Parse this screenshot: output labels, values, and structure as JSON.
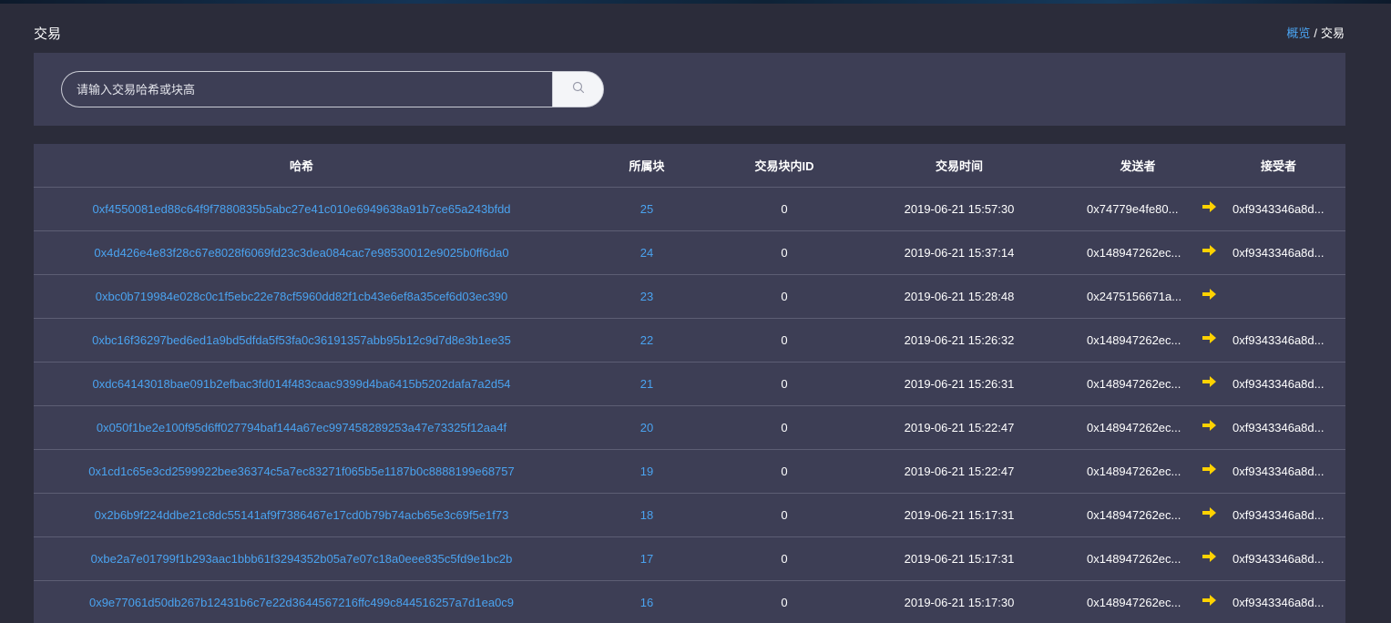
{
  "header": {
    "title": "交易",
    "breadcrumb": {
      "home": "概览",
      "separator": "/",
      "current": "交易"
    }
  },
  "search": {
    "placeholder": "请输入交易哈希或块高",
    "value": "",
    "icon": "search-icon"
  },
  "table": {
    "columns": {
      "hash": "哈希",
      "block": "所属块",
      "tx_index": "交易块内ID",
      "time": "交易时间",
      "sender": "发送者",
      "receiver": "接受者"
    },
    "arrow_icon": "arrow-right-icon",
    "arrow_color": "#ffd200",
    "link_color": "#4aa3f0",
    "rows": [
      {
        "hash": "0xf4550081ed88c64f9f7880835b5abc27e41c010e6949638a91b7ce65a243bfdd",
        "block": "25",
        "tx_index": "0",
        "time": "2019-06-21 15:57:30",
        "sender": "0x74779e4fe80...",
        "receiver": "0xf9343346a8d..."
      },
      {
        "hash": "0x4d426e4e83f28c67e8028f6069fd23c3dea084cac7e98530012e9025b0ff6da0",
        "block": "24",
        "tx_index": "0",
        "time": "2019-06-21 15:37:14",
        "sender": "0x148947262ec...",
        "receiver": "0xf9343346a8d..."
      },
      {
        "hash": "0xbc0b719984e028c0c1f5ebc22e78cf5960dd82f1cb43e6ef8a35cef6d03ec390",
        "block": "23",
        "tx_index": "0",
        "time": "2019-06-21 15:28:48",
        "sender": "0x2475156671a...",
        "receiver": ""
      },
      {
        "hash": "0xbc16f36297bed6ed1a9bd5dfda5f53fa0c36191357abb95b12c9d7d8e3b1ee35",
        "block": "22",
        "tx_index": "0",
        "time": "2019-06-21 15:26:32",
        "sender": "0x148947262ec...",
        "receiver": "0xf9343346a8d..."
      },
      {
        "hash": "0xdc64143018bae091b2efbac3fd014f483caac9399d4ba6415b5202dafa7a2d54",
        "block": "21",
        "tx_index": "0",
        "time": "2019-06-21 15:26:31",
        "sender": "0x148947262ec...",
        "receiver": "0xf9343346a8d..."
      },
      {
        "hash": "0x050f1be2e100f95d6ff027794baf144a67ec997458289253a47e73325f12aa4f",
        "block": "20",
        "tx_index": "0",
        "time": "2019-06-21 15:22:47",
        "sender": "0x148947262ec...",
        "receiver": "0xf9343346a8d..."
      },
      {
        "hash": "0x1cd1c65e3cd2599922bee36374c5a7ec83271f065b5e1187b0c8888199e68757",
        "block": "19",
        "tx_index": "0",
        "time": "2019-06-21 15:22:47",
        "sender": "0x148947262ec...",
        "receiver": "0xf9343346a8d..."
      },
      {
        "hash": "0x2b6b9f224ddbe21c8dc55141af9f7386467e17cd0b79b74acb65e3c69f5e1f73",
        "block": "18",
        "tx_index": "0",
        "time": "2019-06-21 15:17:31",
        "sender": "0x148947262ec...",
        "receiver": "0xf9343346a8d..."
      },
      {
        "hash": "0xbe2a7e01799f1b293aac1bbb61f3294352b05a7e07c18a0eee835c5fd9e1bc2b",
        "block": "17",
        "tx_index": "0",
        "time": "2019-06-21 15:17:31",
        "sender": "0x148947262ec...",
        "receiver": "0xf9343346a8d..."
      },
      {
        "hash": "0x9e77061d50db267b12431b6c7e22d3644567216ffc499c844516257a7d1ea0c9",
        "block": "16",
        "tx_index": "0",
        "time": "2019-06-21 15:17:30",
        "sender": "0x148947262ec...",
        "receiver": "0xf9343346a8d..."
      }
    ]
  }
}
